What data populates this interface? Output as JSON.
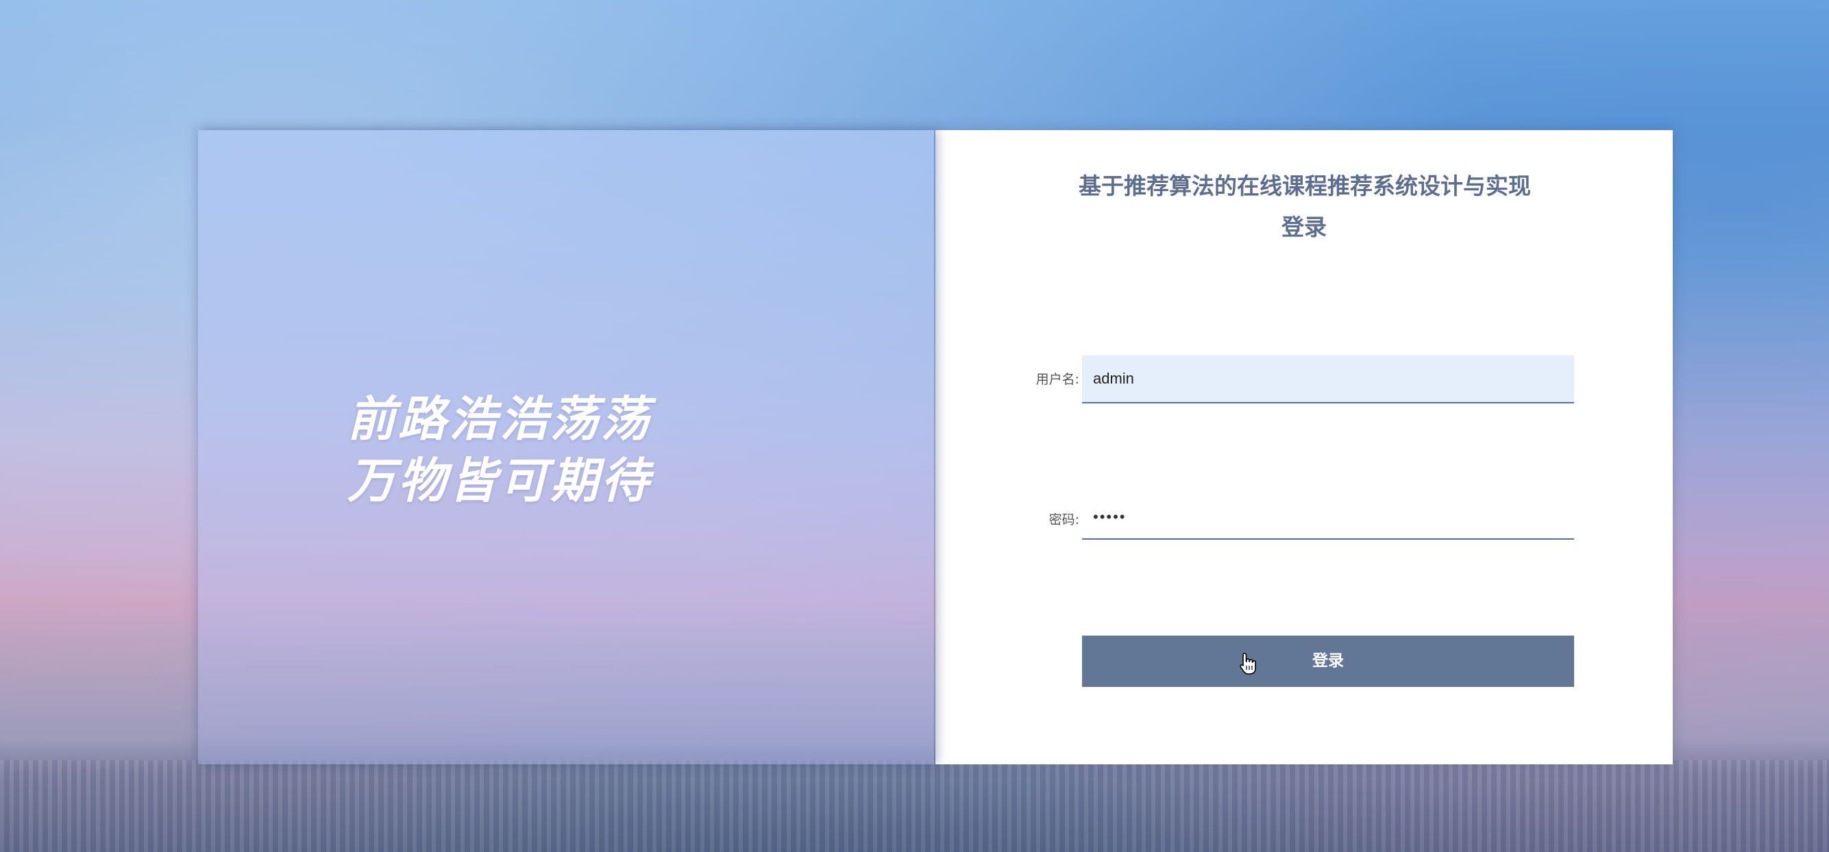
{
  "slogan": {
    "line1": "前路浩浩荡荡",
    "line2": "万物皆可期待"
  },
  "header": {
    "title_line1": "基于推荐算法的在线课程推荐系统设计与实现",
    "title_line2": "登录"
  },
  "form": {
    "username_label": "用户名:",
    "username_value": "admin",
    "password_label": "密码:",
    "password_masked": "•••••",
    "login_button": "登录"
  },
  "cursor": {
    "icon": "hand-pointer-icon"
  },
  "colors": {
    "title": "#5b6e8f",
    "button_bg": "#627696",
    "input_active_bg": "#e5effb",
    "input_underline": "#5b7096"
  }
}
